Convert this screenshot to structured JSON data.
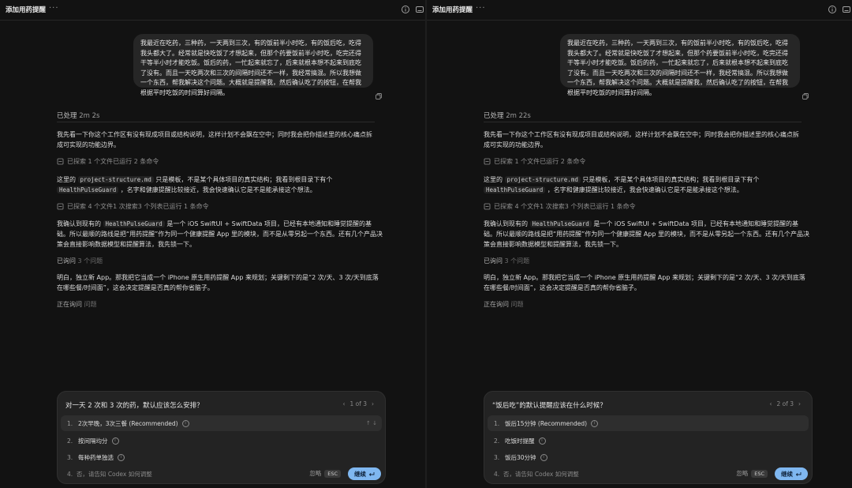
{
  "panes": [
    {
      "title": "添加用药提醒",
      "more": "···",
      "user_message": "我最近在吃药，三种药，一天两到三次，有的饭前半小时吃，有的饭后吃，吃得我头都大了。经常就是快吃饭了才想起来，但那个药要饭前半小时吃，吃完还得干等半小时才能吃饭。饭后的药，一忙起来就忘了，后来就根本想不起来到底吃了没有。而且一天吃两次和三次的间隔时间还不一样，我经常搞混。所以我想做一个东西，帮我解决这个问题。大概就是提醒我，然后确认吃了的按钮，在帮我根据平时吃饭的时间算好间隔。",
      "processed_label": "已处理",
      "processed_duration": "2m 2s",
      "intro": "我先看一下你这个工作区有没有现成项目或结构说明，这样计划不会飘在空中；同时我会把你描述里的核心痛点拆成可实现的功能边界。",
      "step1": "已探索 1 个文件已运行 2 条命令",
      "p2_a": "这里的",
      "p2_code1": "project-structure.md",
      "p2_b": "只是模板，不是某个具体项目的真实结构；我看到根目录下有个",
      "p2_code2": "HealthPulseGuard",
      "p2_c": "，名字和健康提醒比较接近，我会快速确认它是不是能承接这个想法。",
      "step2": "已探索 4 个文件1 次搜索3 个列表已运行 1 条命令",
      "p3_a": "我确认到现有的",
      "p3_code": "HealthPulseGuard",
      "p3_b": "是一个 iOS SwiftUI + SwiftData 项目，已经有本地通知和睡觉提醒的基础。所以最顺的路线是把“用药提醒”作为同一个健康提醒 App 里的模块，而不是从零另起一个东西。还有几个产品决策会直接影响数据模型和提醒算法，我先锁一下。",
      "asked_a": "已询问",
      "asked_b": "3 个问题",
      "p4": "明白，独立新 App。那我把它当成一个 iPhone 原生用药提醒 App 来规划；关键剩下的是“2 次/天、3 次/天到底落在哪些餐/时间面”，这会决定提醒是否真的帮你省脑子。",
      "asking_a": "正在询问",
      "asking_b": "问题",
      "card": {
        "question": "对一天 2 次和 3 次的药，默认应该怎么安排？",
        "pager": "1 of 3",
        "options": [
          {
            "num": "1.",
            "label": "2次早晚，3次三餐 (Recommended)"
          },
          {
            "num": "2.",
            "label": "按间隔均分"
          },
          {
            "num": "3.",
            "label": "每种药单独选"
          }
        ],
        "other": "否，请告知 Codex 如何调整",
        "other_num": "4.",
        "ignore": "忽略",
        "esc": "ESC",
        "continue": "继续",
        "arrows": "↑ ↓"
      }
    },
    {
      "title": "添加用药提醒",
      "more": "···",
      "user_message": "我最近在吃药，三种药，一天两到三次，有的饭前半小时吃，有的饭后吃，吃得我头都大了。经常就是快吃饭了才想起来，但那个药要饭前半小时吃，吃完还得干等半小时才能吃饭。饭后的药，一忙起来就忘了，后来就根本想不起来到底吃了没有。而且一天吃两次和三次的间隔时间还不一样，我经常搞混。所以我想做一个东西，帮我解决这个问题。大概就是提醒我，然后确认吃了的按钮，在帮我根据平时吃饭的时间算好间隔。",
      "processed_label": "已处理",
      "processed_duration": "2m 22s",
      "intro": "我先看一下你这个工作区有没有现成项目或结构说明，这样计划不会飘在空中；同时我会把你描述里的核心痛点拆成可实现的功能边界。",
      "step1": "已探索 1 个文件已运行 2 条命令",
      "p2_a": "这里的",
      "p2_code1": "project-structure.md",
      "p2_b": "只是模板，不是某个具体项目的真实结构；我看到根目录下有个",
      "p2_code2": "HealthPulseGuard",
      "p2_c": "，名字和健康提醒比较接近，我会快速确认它是不是能承接这个想法。",
      "step2": "已探索 4 个文件1 次搜索3 个列表已运行 1 条命令",
      "p3_a": "我确认到现有的",
      "p3_code": "HealthPulseGuard",
      "p3_b": "是一个 iOS SwiftUI + SwiftData 项目，已经有本地通知和睡觉提醒的基础。所以最顺的路线是把“用药提醒”作为同一个健康提醒 App 里的模块，而不是从零另起一个东西。还有几个产品决策会直接影响数据模型和提醒算法，我先锁一下。",
      "asked_a": "已询问",
      "asked_b": "3 个问题",
      "p4": "明白，独立新 App。那我把它当成一个 iPhone 原生用药提醒 App 来规划；关键剩下的是“2 次/天、3 次/天到底落在哪些餐/时间面”，这会决定提醒是否真的帮你省脑子。",
      "asking_a": "正在询问",
      "asking_b": "问题",
      "card": {
        "question": "“饭后吃”的默认提醒应该在什么时候？",
        "pager": "2 of 3",
        "options": [
          {
            "num": "1.",
            "label": "饭后15分钟 (Recommended)"
          },
          {
            "num": "2.",
            "label": "吃饭时提醒"
          },
          {
            "num": "3.",
            "label": "饭后30分钟"
          }
        ],
        "other": "否，请告知 Codex 如何调整",
        "other_num": "4.",
        "ignore": "忽略",
        "esc": "ESC",
        "continue": "继续",
        "arrows": "↑ ↓"
      }
    }
  ],
  "icons": {
    "info": "info-circle-icon",
    "sidebar": "sidebar-panel-icon",
    "copy": "copy-icon",
    "step": "explore-icon",
    "enter": "return-icon"
  },
  "colors": {
    "background": "#121212",
    "bubble": "#262626",
    "card": "#232323",
    "accent": "#7fb7f0"
  }
}
